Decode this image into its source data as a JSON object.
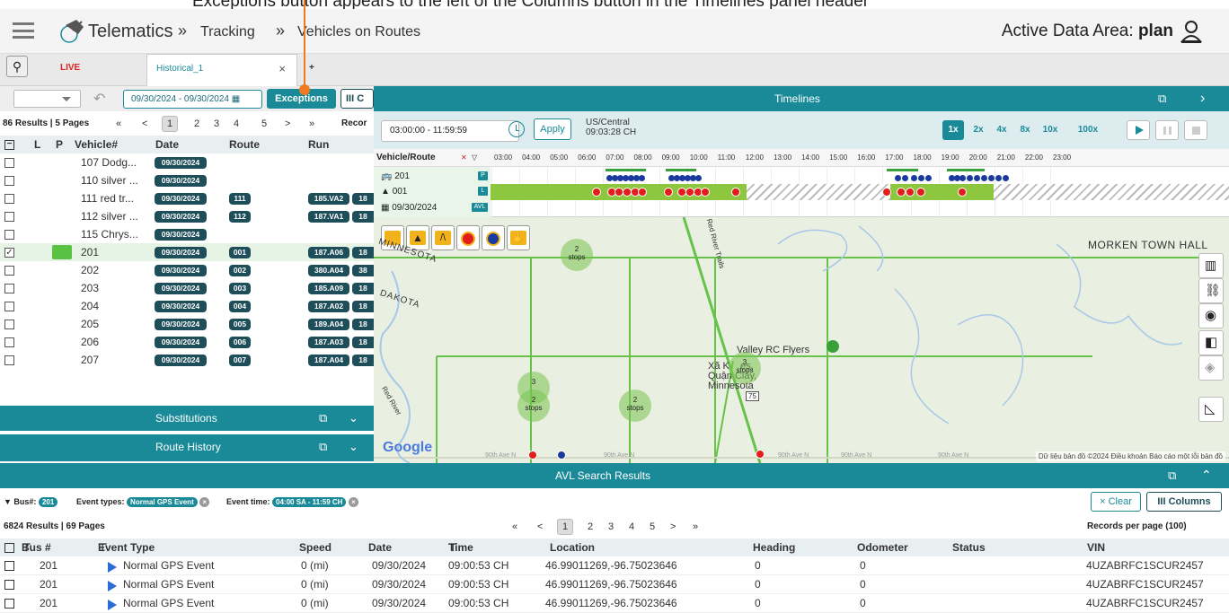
{
  "top_note": "Exceptions button appears to the left of the Columns button in the Timelines panel header",
  "header": {
    "brand": "Telematics",
    "crumb1": "Tracking",
    "crumb2": "Vehicles on Routes",
    "area_label": "Active Data Area:",
    "area_value": "plan",
    "sep": "»"
  },
  "tabs": {
    "live": "LIVE",
    "historical": "Historical_1",
    "close": "×",
    "add": "+"
  },
  "toolbar": {
    "date_range": "09/30/2024 - 09/30/2024",
    "exceptions": "Exceptions",
    "columns": "III C"
  },
  "vehicle_pager": {
    "count": "86 Results | 5 Pages",
    "pages": [
      "1",
      "2",
      "3",
      "4",
      "5"
    ],
    "first": "«",
    "prev": "<",
    "next": ">",
    "last": "»",
    "records": "Recor"
  },
  "vehicle_columns": {
    "l": "L",
    "p": "P",
    "vehicle": "Vehicle#",
    "date": "Date",
    "route": "Route",
    "run": "Run"
  },
  "vehicles": [
    {
      "name": "107 Dodg...",
      "date": "09/30/2024",
      "route": "",
      "run": "",
      "run2": ""
    },
    {
      "name": "110 silver ...",
      "date": "09/30/2024",
      "route": "",
      "run": "",
      "run2": ""
    },
    {
      "name": "111 red tr...",
      "date": "09/30/2024",
      "route": "111",
      "run": "185.VA2",
      "run2": "18"
    },
    {
      "name": "112 silver ...",
      "date": "09/30/2024",
      "route": "112",
      "run": "187.VA1",
      "run2": "18"
    },
    {
      "name": "115 Chrys...",
      "date": "09/30/2024",
      "route": "",
      "run": "",
      "run2": ""
    },
    {
      "name": "201",
      "date": "09/30/2024",
      "route": "001",
      "run": "187.A06",
      "run2": "18"
    },
    {
      "name": "202",
      "date": "09/30/2024",
      "route": "002",
      "run": "380.A04",
      "run2": "38"
    },
    {
      "name": "203",
      "date": "09/30/2024",
      "route": "003",
      "run": "185.A09",
      "run2": "18"
    },
    {
      "name": "204",
      "date": "09/30/2024",
      "route": "004",
      "run": "187.A02",
      "run2": "18"
    },
    {
      "name": "205",
      "date": "09/30/2024",
      "route": "005",
      "run": "189.A04",
      "run2": "18"
    },
    {
      "name": "206",
      "date": "09/30/2024",
      "route": "006",
      "run": "187.A03",
      "run2": "18"
    },
    {
      "name": "207",
      "date": "09/30/2024",
      "route": "007",
      "run": "187.A04",
      "run2": "18"
    }
  ],
  "sections": {
    "substitutions": "Substitutions",
    "route_history": "Route History"
  },
  "timelines": {
    "title": "Timelines",
    "time_range": "03:00:00  -  11:59:59",
    "apply": "Apply",
    "tz": "US/Central",
    "current": "09:03:28 CH",
    "speeds": [
      "1x",
      "2x",
      "4x",
      "8x",
      "10x",
      "100x"
    ],
    "vr_label": "Vehicle/Route",
    "hours": [
      "03:00",
      "04:00",
      "05:00",
      "06:00",
      "07:00",
      "08:00",
      "09:00",
      "10:00",
      "11:00",
      "12:00",
      "13:00",
      "14:00",
      "15:00",
      "16:00",
      "17:00",
      "18:00",
      "19:00",
      "20:00",
      "21:00",
      "22:00",
      "23:00"
    ],
    "row_vehicle": "201",
    "row_route": "001",
    "row_date": "09/30/2024",
    "p": "P",
    "l": "L",
    "avl": "AVL"
  },
  "map": {
    "clusters": [
      {
        "n": "2",
        "t": "stops"
      },
      {
        "n": "3",
        "t": ""
      },
      {
        "n": "2",
        "t": "stops"
      },
      {
        "n": "2",
        "t": "stops"
      },
      {
        "n": "3",
        "t": "stops"
      }
    ],
    "labels": {
      "minnesota": "MINNESOTA",
      "dakota": "DAKOTA",
      "valley": "Valley RC Flyers",
      "town": "Xã K    es,\nQuận Clay,\nMinnesota",
      "morken": "MORKEN TOWN HALL",
      "river": "Red River",
      "hwy": "75",
      "road": "Red River Trails"
    },
    "attribution": "Dữ liệu bản đồ ©2024  Điều khoản  Báo cáo một lỗi bản đồ",
    "google": "Google",
    "ave_labels": [
      "90th Ave N",
      "90th Ave N",
      "90th Ave N",
      "90th Ave N",
      "90th Ave N"
    ]
  },
  "avl": {
    "title": "AVL Search Results",
    "filter_bus_label": "Bus#:",
    "filter_bus": "201",
    "filter_types_label": "Event types:",
    "filter_types": "Normal GPS Event",
    "filter_time_label": "Event time:",
    "filter_time": "04:00 SA - 11:59 CH",
    "clear": "× Clear",
    "columns": "III Columns",
    "count": "6824 Results | 69 Pages",
    "pages": [
      "1",
      "2",
      "3",
      "4",
      "5"
    ],
    "first": "«",
    "prev": "<",
    "next": ">",
    "last": "»",
    "records": "Records per page (100)",
    "headers": {
      "bus": "Bus #",
      "event": "Event Type",
      "speed": "Speed",
      "date": "Date",
      "time": "Time",
      "location": "Location",
      "heading": "Heading",
      "odometer": "Odometer",
      "status": "Status",
      "vin": "VIN"
    },
    "rows": [
      {
        "bus": "201",
        "event": "Normal GPS Event",
        "speed": "0 (mi)",
        "date": "09/30/2024",
        "time": "09:00:53 CH",
        "location": "46.99011269,-96.75023646",
        "heading": "0",
        "odometer": "0",
        "status": "",
        "vin": "4UZABRFC1SCUR2457"
      },
      {
        "bus": "201",
        "event": "Normal GPS Event",
        "speed": "0 (mi)",
        "date": "09/30/2024",
        "time": "09:00:53 CH",
        "location": "46.99011269,-96.75023646",
        "heading": "0",
        "odometer": "0",
        "status": "",
        "vin": "4UZABRFC1SCUR2457"
      },
      {
        "bus": "201",
        "event": "Normal GPS Event",
        "speed": "0 (mi)",
        "date": "09/30/2024",
        "time": "09:00:53 CH",
        "location": "46.99011269,-96.75023646",
        "heading": "0",
        "odometer": "0",
        "status": "",
        "vin": "4UZABRFC1SCUR2457"
      }
    ]
  },
  "colors": {
    "teal": "#1a8a98",
    "dark_badge": "#1e4e5a",
    "green": "#8dc63f",
    "red": "#e31c1c"
  }
}
